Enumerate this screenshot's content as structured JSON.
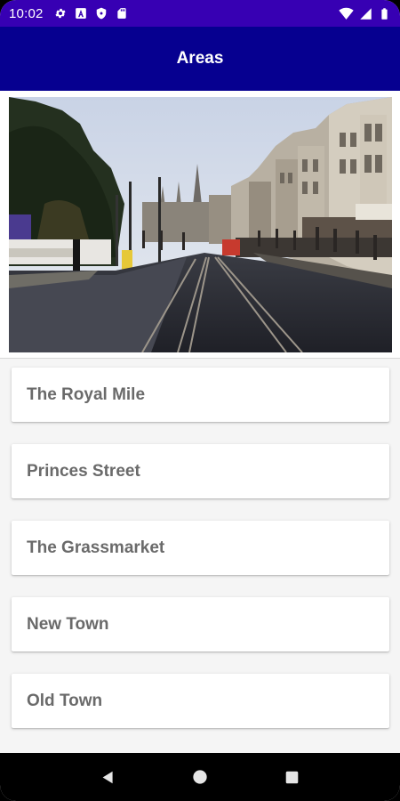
{
  "status_bar": {
    "time": "10:02",
    "left_icons": [
      "gear-icon",
      "font-a-icon",
      "shield-icon",
      "sd-card-icon"
    ],
    "right_icons": [
      "wifi-icon",
      "cellular-signal-icon",
      "battery-icon"
    ],
    "background": "#3700b3"
  },
  "app_bar": {
    "title": "Areas",
    "background": "#060090"
  },
  "hero_image": {
    "subject": "street-scene-photo"
  },
  "areas": [
    {
      "label": "The Royal Mile"
    },
    {
      "label": "Princes Street"
    },
    {
      "label": "The Grassmarket"
    },
    {
      "label": "New Town"
    },
    {
      "label": "Old Town"
    }
  ],
  "nav_bar": {
    "buttons": [
      "back-icon",
      "home-icon",
      "recents-icon"
    ]
  }
}
